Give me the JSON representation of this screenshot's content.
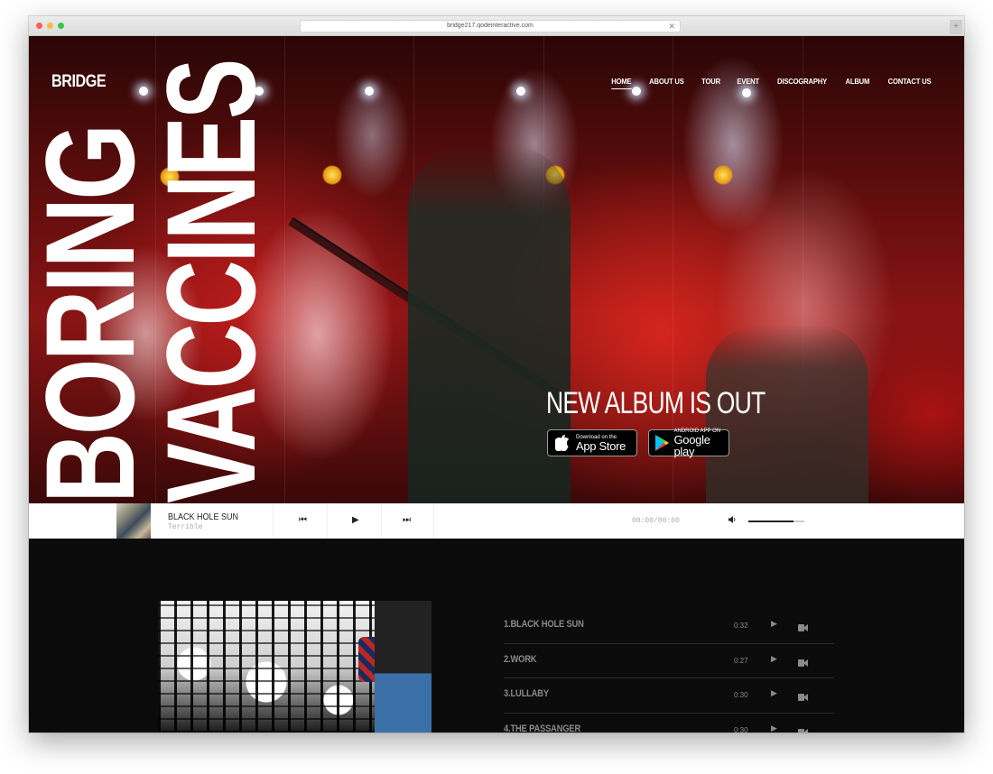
{
  "browser": {
    "url": "bridge217.qodeinteractive.com",
    "close_glyph": "✕",
    "new_tab_glyph": "+"
  },
  "header": {
    "logo": "BRIDGE",
    "nav": [
      {
        "label": "HOME",
        "active": true
      },
      {
        "label": "ABOUT US",
        "active": false
      },
      {
        "label": "TOUR",
        "active": false
      },
      {
        "label": "EVENT",
        "active": false
      },
      {
        "label": "DISCOGRAPHY",
        "active": false
      },
      {
        "label": "ALBUM",
        "active": false
      },
      {
        "label": "CONTACT US",
        "active": false
      }
    ]
  },
  "hero": {
    "vertical_word_1": "BORING",
    "vertical_word_2": "VACCINES",
    "headline": "NEW ALBUM IS OUT",
    "app_store": {
      "small": "Download on the",
      "big": "App Store",
      "icon": "apple-icon"
    },
    "google_play": {
      "small": "ANDROID APP ON",
      "big": "Google play",
      "icon": "google-play-icon"
    }
  },
  "player": {
    "track_title": "BLACK HOLE SUN",
    "artist": "Terrible",
    "prev_glyph": "⏮",
    "play_glyph": "▶",
    "next_glyph": "⏭",
    "time": "00:00/00:00",
    "volume_glyph": "🔈",
    "volume_level": 0.8
  },
  "tracklist": [
    {
      "name": "1.BLACK HOLE SUN",
      "duration": "0:32",
      "play_glyph": "▶"
    },
    {
      "name": "2.WORK",
      "duration": "0:27",
      "play_glyph": "▶"
    },
    {
      "name": "3.LULLABY",
      "duration": "0:30",
      "play_glyph": "▶"
    },
    {
      "name": "4.THE PASSANGER",
      "duration": "0:30",
      "play_glyph": "▶"
    }
  ],
  "colors": {
    "page_bg": "#0b0b0b",
    "track_text": "#8a8a8a",
    "hero_red": "#8a1414"
  }
}
